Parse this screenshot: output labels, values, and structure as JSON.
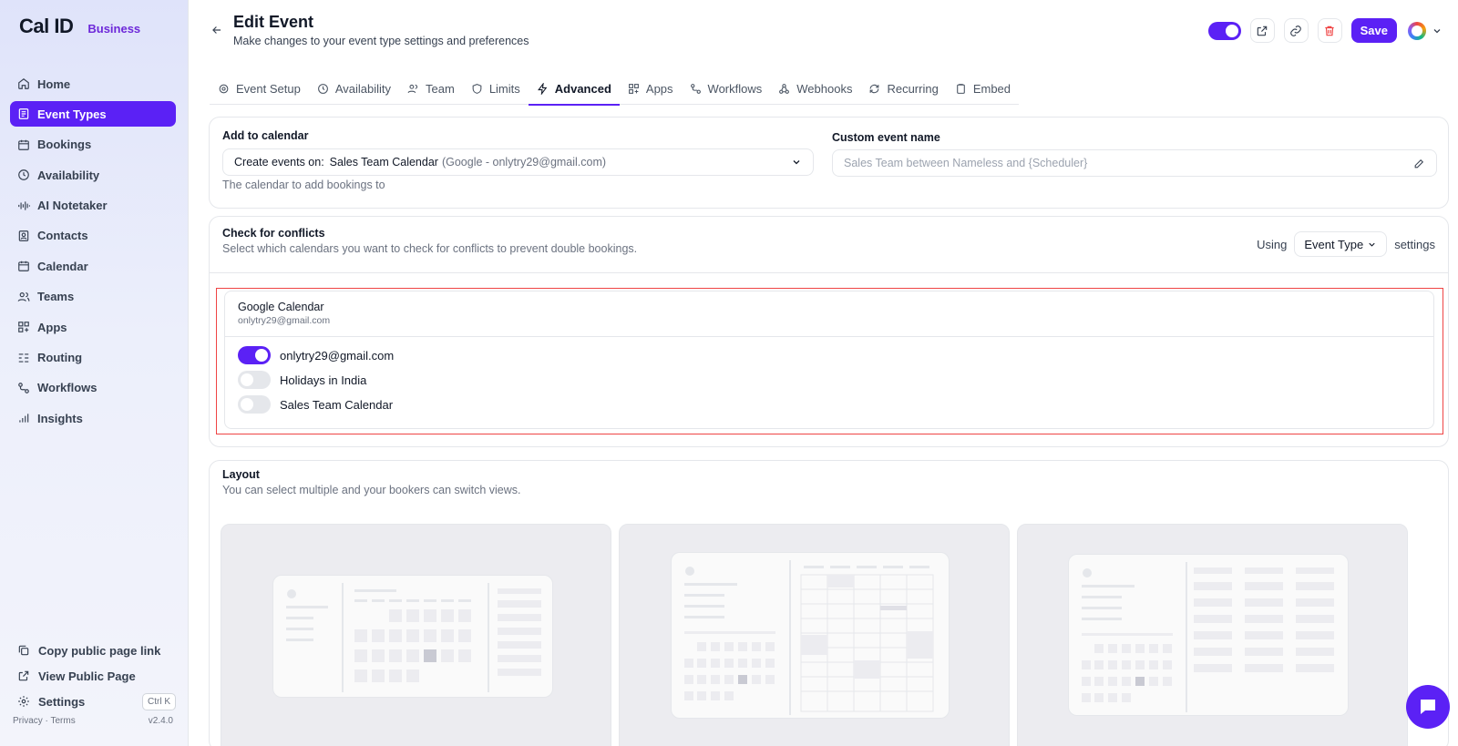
{
  "sidebar": {
    "logo": "Cal ID",
    "badge": "Business",
    "items": [
      {
        "label": "Home",
        "icon": "home-icon"
      },
      {
        "label": "Event Types",
        "icon": "event-types-icon",
        "active": true
      },
      {
        "label": "Bookings",
        "icon": "calendar-icon"
      },
      {
        "label": "Availability",
        "icon": "clock-icon"
      },
      {
        "label": "AI Notetaker",
        "icon": "audio-wave-icon"
      },
      {
        "label": "Contacts",
        "icon": "contacts-icon"
      },
      {
        "label": "Calendar",
        "icon": "calendar-icon"
      },
      {
        "label": "Teams",
        "icon": "users-icon"
      },
      {
        "label": "Apps",
        "icon": "apps-icon"
      },
      {
        "label": "Routing",
        "icon": "routing-icon"
      },
      {
        "label": "Workflows",
        "icon": "workflows-icon"
      },
      {
        "label": "Insights",
        "icon": "bar-chart-icon"
      }
    ],
    "bottom": {
      "copy_link": "Copy public page link",
      "view_public": "View Public Page",
      "settings": "Settings",
      "settings_shortcut": "Ctrl K"
    },
    "footer": {
      "privacy_terms": "Privacy · Terms",
      "version": "v2.4.0"
    }
  },
  "header": {
    "title": "Edit Event",
    "subtitle": "Make changes to your event type settings and preferences",
    "save_label": "Save",
    "hidden_toggle_on": true
  },
  "tabs": [
    {
      "label": "Event Setup",
      "icon": "gear-icon"
    },
    {
      "label": "Availability",
      "icon": "clock-icon"
    },
    {
      "label": "Team",
      "icon": "users-icon"
    },
    {
      "label": "Limits",
      "icon": "shield-icon"
    },
    {
      "label": "Advanced",
      "icon": "bolt-icon",
      "active": true
    },
    {
      "label": "Apps",
      "icon": "apps-icon"
    },
    {
      "label": "Workflows",
      "icon": "workflows-icon"
    },
    {
      "label": "Webhooks",
      "icon": "webhook-icon"
    },
    {
      "label": "Recurring",
      "icon": "repeat-icon"
    },
    {
      "label": "Embed",
      "icon": "clipboard-icon"
    }
  ],
  "add_to_calendar": {
    "label": "Add to calendar",
    "prefix": "Create events on:",
    "calendar": "Sales Team Calendar",
    "account": "(Google - onlytry29@gmail.com)",
    "hint": "The calendar to add bookings to"
  },
  "custom_event_name": {
    "label": "Custom event name",
    "placeholder": "Sales Team between Nameless and {Scheduler}"
  },
  "conflicts": {
    "title": "Check for conflicts",
    "description": "Select which calendars you want to check for conflicts to prevent double bookings.",
    "using": "Using",
    "selected": "Event Type",
    "settings": "settings",
    "provider": "Google Calendar",
    "account": "onlytry29@gmail.com",
    "calendars": [
      {
        "name": "onlytry29@gmail.com",
        "enabled": true
      },
      {
        "name": "Holidays in India",
        "enabled": false
      },
      {
        "name": "Sales Team Calendar",
        "enabled": false
      }
    ]
  },
  "layout": {
    "title": "Layout",
    "description": "You can select multiple and your bookers can switch views."
  },
  "colors": {
    "accent": "#5b21f5",
    "highlight": "#ef4444"
  }
}
